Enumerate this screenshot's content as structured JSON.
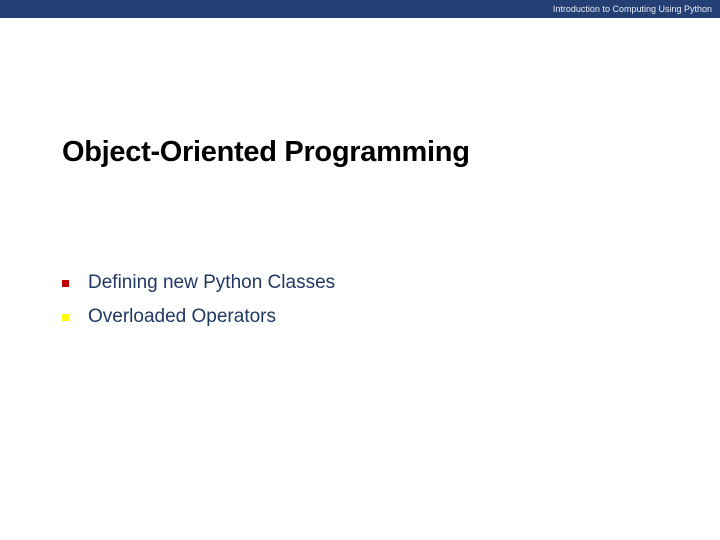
{
  "header": {
    "course_title": "Introduction to Computing Using Python"
  },
  "slide": {
    "title": "Object-Oriented Programming",
    "bullets": [
      {
        "text": "Defining new Python Classes",
        "marker_color": "#c00000"
      },
      {
        "text": "Overloaded Operators",
        "marker_color": "#ffff00"
      }
    ]
  },
  "colors": {
    "header_bar": "#243f73",
    "bullet_text": "#1f3864"
  }
}
